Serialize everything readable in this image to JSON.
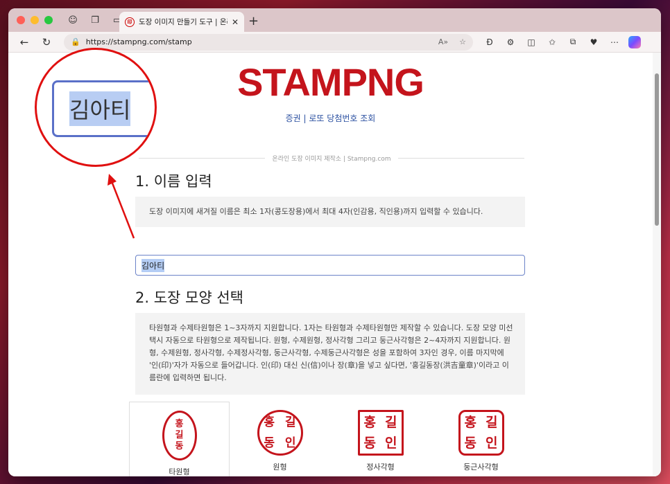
{
  "browser": {
    "tab_title": "도장 이미지 만들기 도구 | 온라인 도",
    "tab_favicon": "印",
    "url": "https://stampng.com/stamp",
    "read_aloud": "A»"
  },
  "page": {
    "logo": "STAMPNG",
    "nav_link": "증권 | 로또 당첨번호 조회",
    "divider_text": "온라인 도장 이미지 제작소 | Stampng.com",
    "section1": {
      "title": "1. 이름 입력",
      "description": "도장 이미지에 새겨질 이름은 최소 1자(콩도장용)에서 최대 4자(인감용, 직인용)까지 입력할 수 있습니다.",
      "input_value": "김아티"
    },
    "section2": {
      "title": "2. 도장 모양 선택",
      "description": "타원형과 수제타원형은 1~3자까지 지원합니다. 1자는 타원형과 수제타원형만 제작할 수 있습니다. 도장 모양 미선택시 자동으로 타원형으로 제작됩니다. 원형, 수제원형, 정사각형 그리고 둥근사각형은 2~4자까지 지원합니다. 원형, 수제원형, 정사각형, 수제정사각형, 둥근사각형, 수제둥근사각형은 성을 포함하여 3자인 경우, 이름 마지막에 '인(印)'자가 자동으로 들어갑니다. 인(印) 대신 신(信)이나 장(章)을 넣고 싶다면, '홍길동장(洪吉童章)'이라고 이름란에 입력하면 됩니다.",
      "shapes": [
        {
          "label": "타원형",
          "chars": [
            "홍",
            "길",
            "동"
          ]
        },
        {
          "label": "원형",
          "chars": [
            "홍",
            "길",
            "동",
            "인"
          ]
        },
        {
          "label": "정사각형",
          "chars": [
            "홍",
            "길",
            "동",
            "인"
          ]
        },
        {
          "label": "둥근사각형",
          "chars": [
            "홍",
            "길",
            "동",
            "인"
          ]
        }
      ]
    },
    "zoom_callout_text": "김아티"
  },
  "colors": {
    "brand_red": "#c4141c",
    "link_blue": "#2a4fa0",
    "annotation_red": "#e01010"
  }
}
